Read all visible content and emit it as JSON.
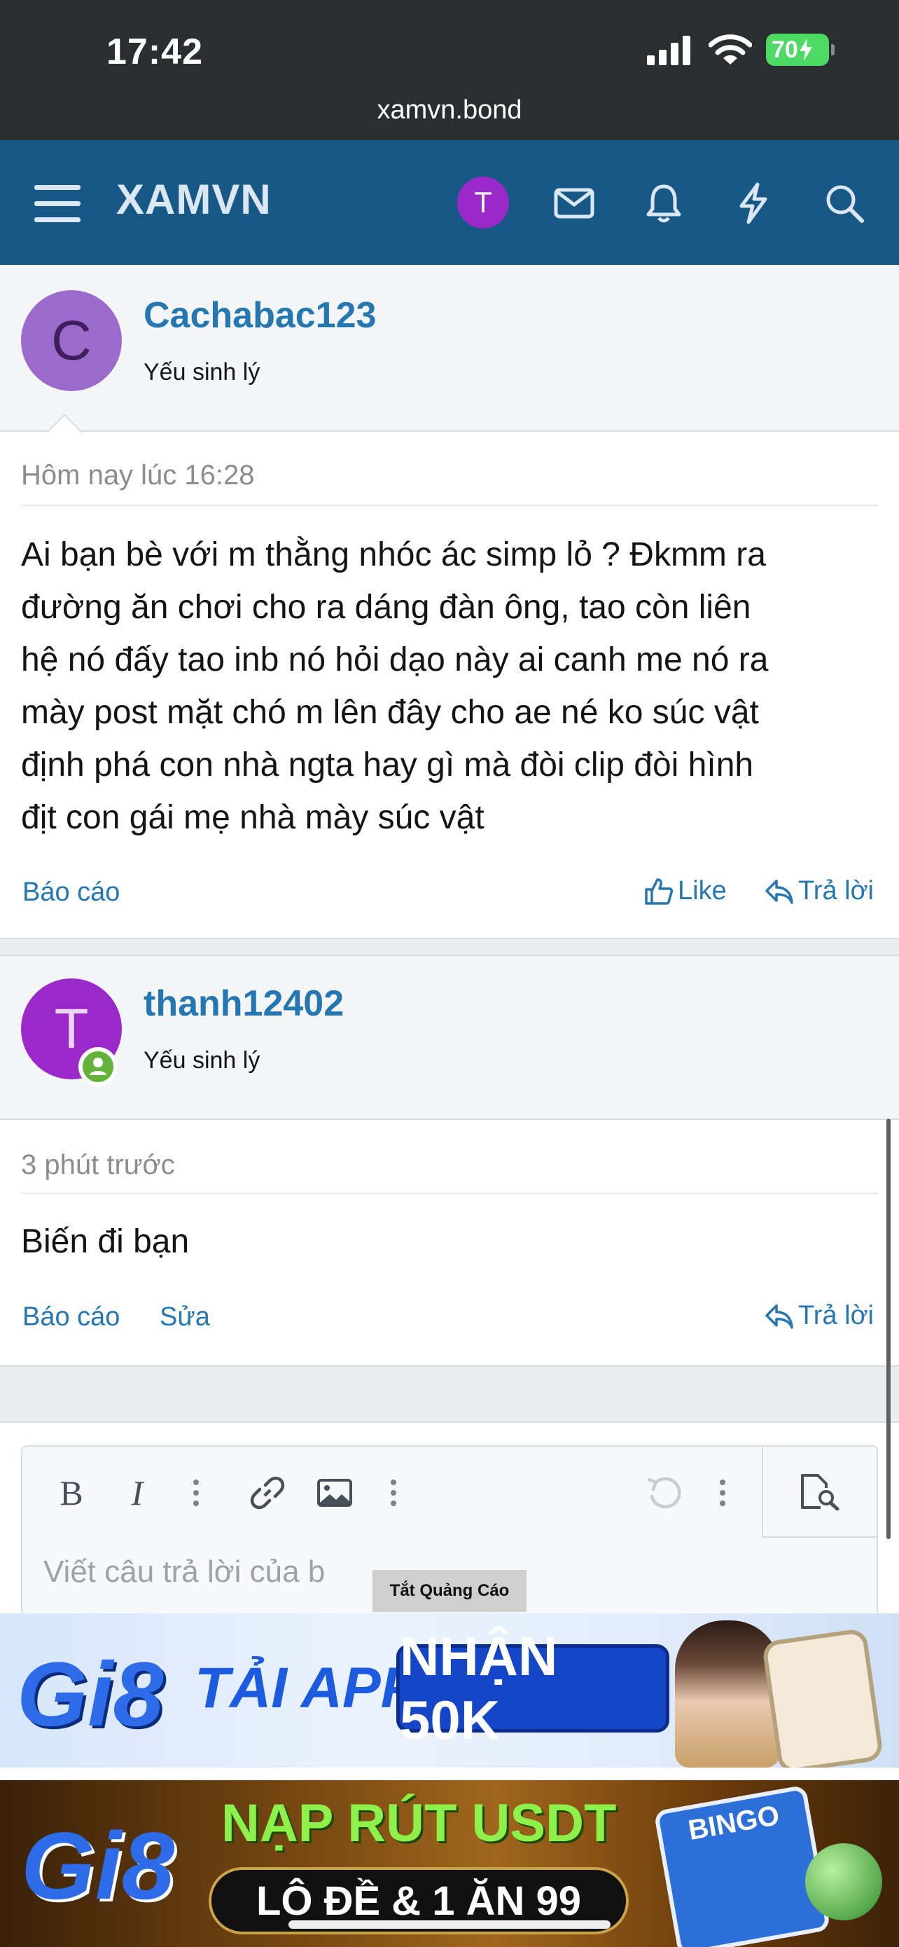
{
  "status": {
    "time": "17:42",
    "battery": "70"
  },
  "browser": {
    "url": "xamvn.bond"
  },
  "nav": {
    "logo": "XAMVN",
    "avatar_letter": "T"
  },
  "posts": [
    {
      "avatar_letter": "C",
      "avatar_color": "#9b6acb",
      "username": "Cachabac123",
      "user_title": "Yếu sinh lý",
      "time": "Hôm nay lúc 16:28",
      "body_lines": [
        "Ai bạn bè với m thằng nhóc ác simp lỏ ? Đkmm ra",
        "đường ăn chơi cho ra dáng đàn ông, tao còn liên",
        "hệ nó đấy tao inb nó hỏi dạo này ai canh me nó ra",
        "mày post mặt chó m lên đây cho ae né ko súc vật",
        "định phá con nhà ngta hay gì mà đòi clip đòi hình",
        "địt con gái mẹ nhà mày súc vật"
      ],
      "actions": {
        "report": "Báo cáo",
        "like": "Like",
        "reply": "Trả lời"
      }
    },
    {
      "avatar_letter": "T",
      "avatar_color": "#9b29c9",
      "username": "thanh12402",
      "user_title": "Yếu sinh lý",
      "time": "3 phút trước",
      "body": "Biến đi bạn",
      "actions": {
        "report": "Báo cáo",
        "edit": "Sửa",
        "reply": "Trả lời"
      }
    }
  ],
  "editor": {
    "placeholder": "Viết câu trả lời của b"
  },
  "ads": {
    "close_label": "Tắt Quảng Cáo",
    "ad1": {
      "brand": "Gi8",
      "text1": "TẢI APP",
      "text2": "NHẬN 50K"
    },
    "ad2": {
      "brand": "Gi8",
      "text1": "NẠP RÚT USDT",
      "text2": "LÔ ĐỀ & 1 ĂN 99",
      "badge": "BINGO"
    }
  }
}
